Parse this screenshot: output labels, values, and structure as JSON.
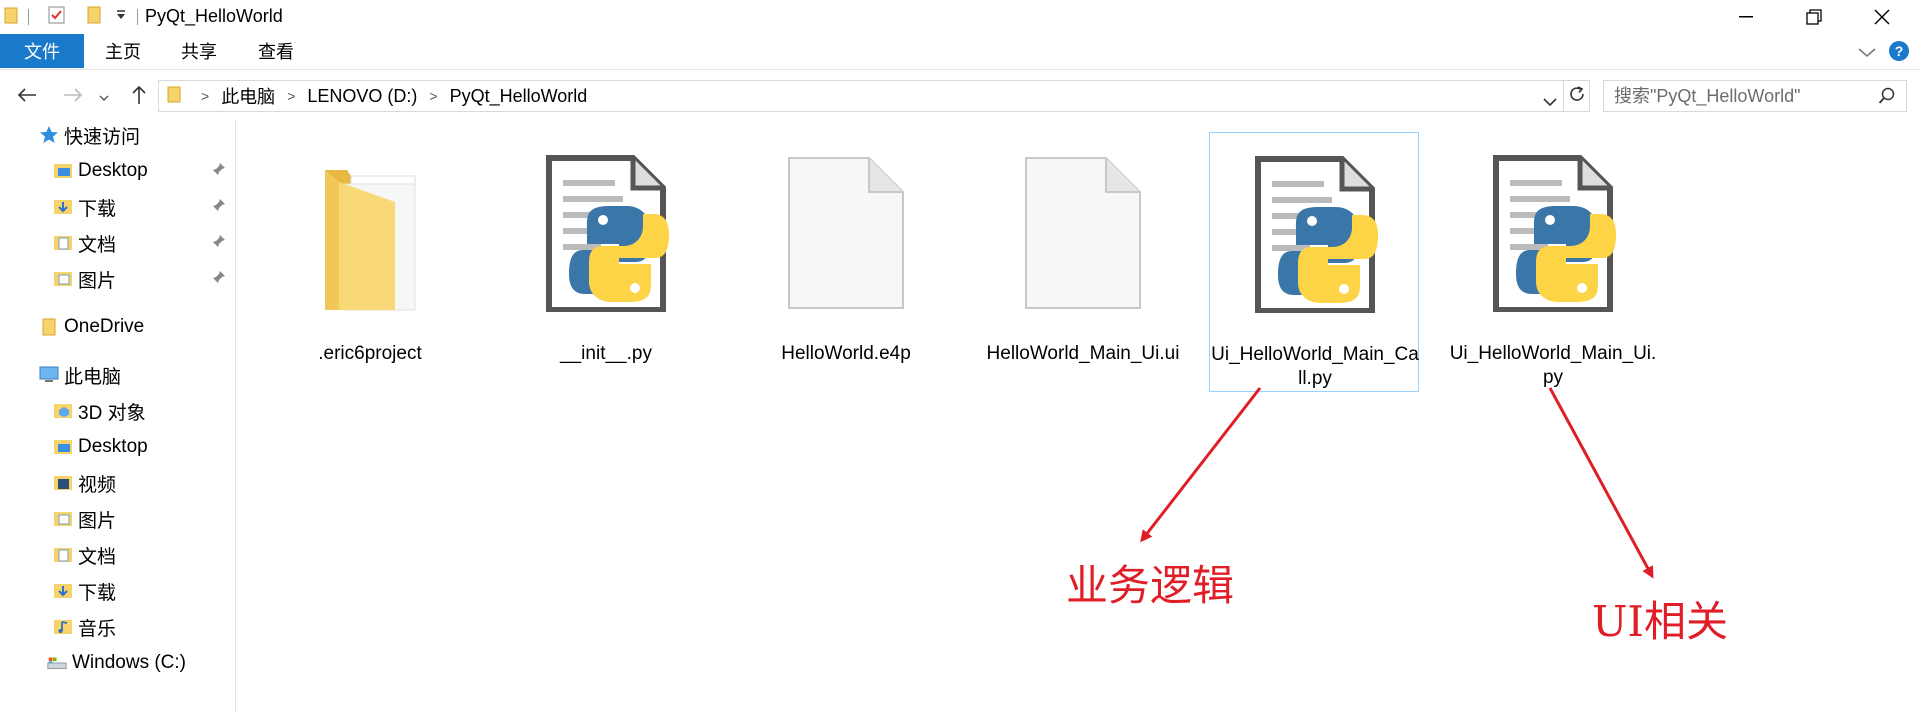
{
  "window": {
    "title": "PyQt_HelloWorld",
    "minimize_icon": "minimize-icon",
    "maximize_icon": "restore-icon",
    "close_icon": "close-icon"
  },
  "ribbon": {
    "tabs": [
      {
        "label": "文件",
        "active": true
      },
      {
        "label": "主页"
      },
      {
        "label": "共享"
      },
      {
        "label": "查看"
      }
    ],
    "accent": "#1979ca"
  },
  "address": {
    "crumbs": [
      "此电脑",
      "LENOVO (D:)",
      "PyQt_HelloWorld"
    ],
    "search_placeholder": "搜索\"PyQt_HelloWorld\""
  },
  "sidebar": {
    "quick_access": {
      "label": "快速访问",
      "items": [
        {
          "label": "Desktop",
          "pinned": true,
          "icon": "desktop-folder-icon"
        },
        {
          "label": "下载",
          "pinned": true,
          "icon": "downloads-folder-icon"
        },
        {
          "label": "文档",
          "pinned": true,
          "icon": "documents-folder-icon"
        },
        {
          "label": "图片",
          "pinned": true,
          "icon": "pictures-folder-icon"
        }
      ]
    },
    "onedrive": {
      "label": "OneDrive"
    },
    "this_pc": {
      "label": "此电脑",
      "items": [
        {
          "label": "3D 对象",
          "icon": "3d-objects-folder-icon"
        },
        {
          "label": "Desktop",
          "icon": "desktop-folder-icon"
        },
        {
          "label": "视频",
          "icon": "videos-folder-icon"
        },
        {
          "label": "图片",
          "icon": "pictures-folder-icon"
        },
        {
          "label": "文档",
          "icon": "documents-folder-icon"
        },
        {
          "label": "下载",
          "icon": "downloads-folder-icon"
        },
        {
          "label": "音乐",
          "icon": "music-folder-icon"
        },
        {
          "label": "Windows (C:)",
          "icon": "drive-icon"
        }
      ]
    }
  },
  "files": [
    {
      "name": ".eric6project",
      "type": "folder"
    },
    {
      "name": "__init__.py",
      "type": "python"
    },
    {
      "name": "HelloWorld.e4p",
      "type": "blank"
    },
    {
      "name": "HelloWorld_Main_Ui.ui",
      "type": "blank"
    },
    {
      "name": "Ui_HelloWorld_Main_Call.py",
      "type": "python",
      "selected": true
    },
    {
      "name": "Ui_HelloWorld_Main_Ui.py",
      "type": "python"
    }
  ],
  "annotations": [
    {
      "text": "业务逻辑"
    },
    {
      "text": "UI相关"
    }
  ],
  "annotation_color": "#e01e27"
}
